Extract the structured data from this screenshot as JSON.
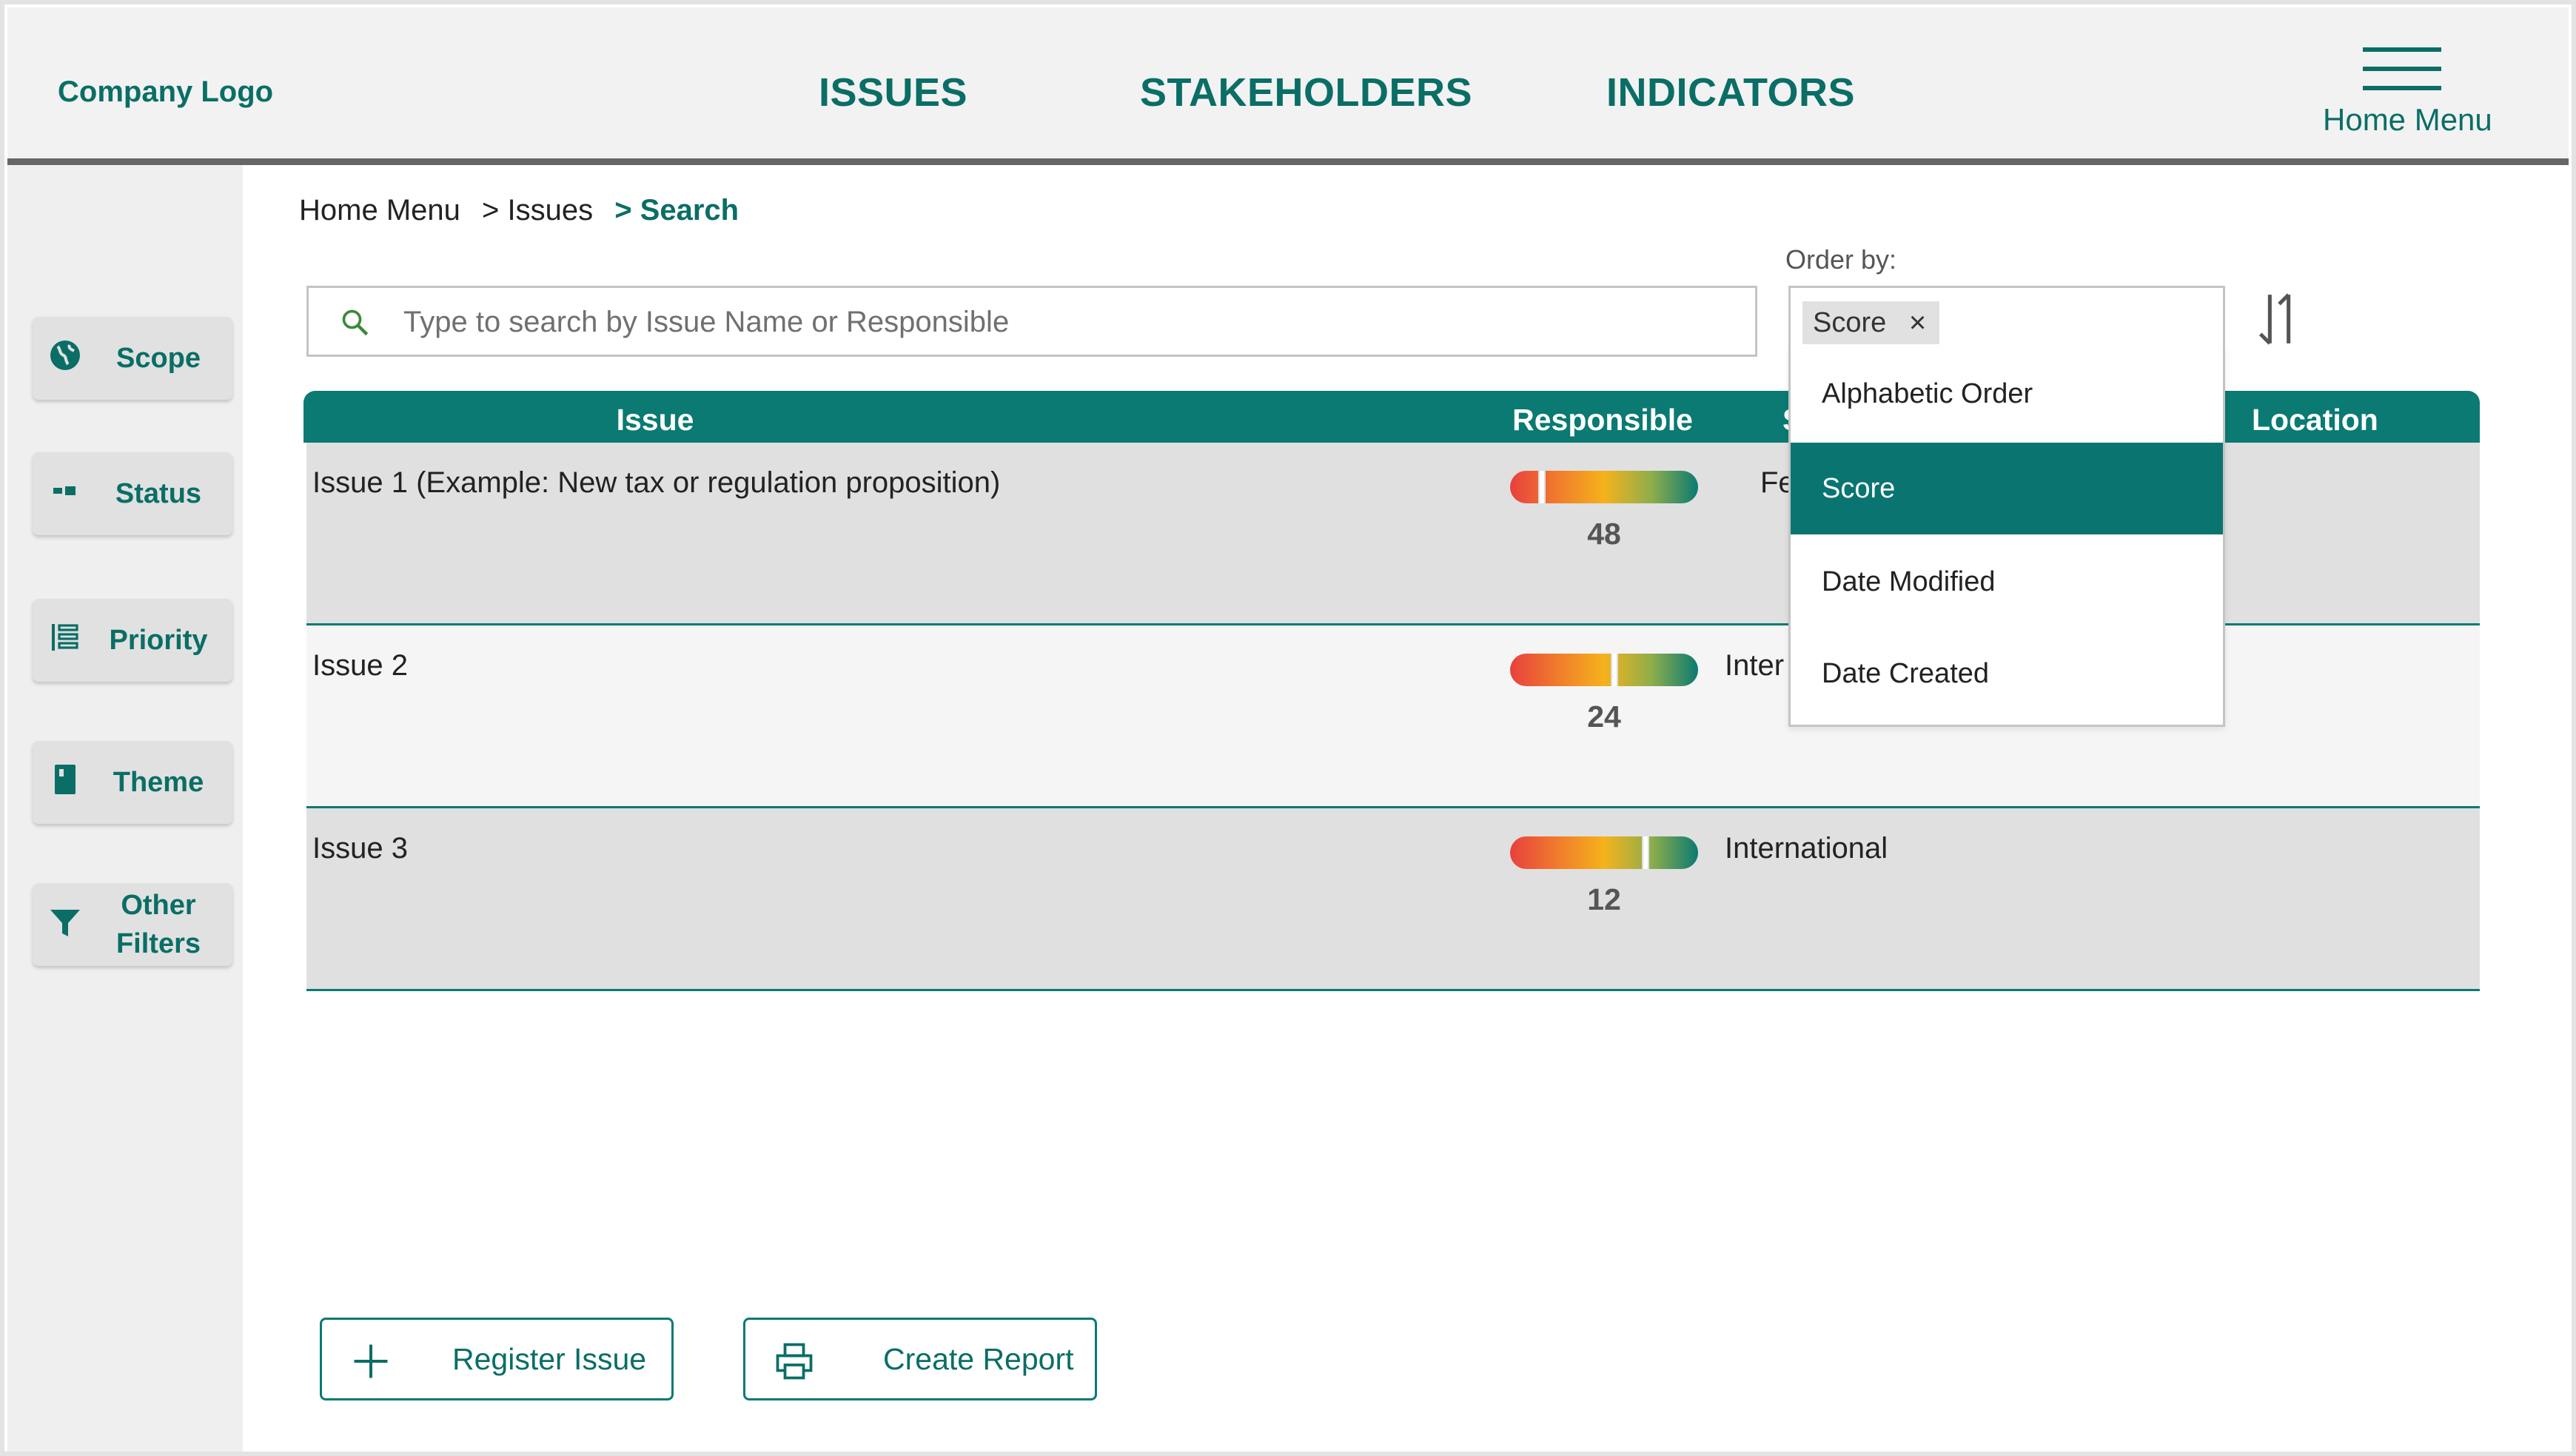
{
  "header": {
    "logo": "Company Logo",
    "nav": [
      "ISSUES",
      "STAKEHOLDERS",
      "INDICATORS"
    ],
    "home_menu": "Home Menu"
  },
  "sidebar": {
    "items": [
      {
        "label": "Scope",
        "icon": "globe-icon"
      },
      {
        "label": "Status",
        "icon": "status-icon"
      },
      {
        "label": "Priority",
        "icon": "priority-list-icon"
      },
      {
        "label": "Theme",
        "icon": "book-icon"
      },
      {
        "label": "Other Filters",
        "icon": "filter-icon"
      }
    ]
  },
  "breadcrumb": {
    "items": [
      "Home Menu",
      "> Issues",
      "> Search"
    ]
  },
  "search": {
    "placeholder": "Type to search by Issue Name or Responsible",
    "value": ""
  },
  "order_by": {
    "label": "Order by:",
    "selected": "Score",
    "options": [
      "Alphabetic Order",
      "Score",
      "Date Modified",
      "Date Created"
    ]
  },
  "table": {
    "columns": [
      "Issue",
      "Responsible",
      "Score",
      "Sc",
      "Location"
    ],
    "rows": [
      {
        "issue": "Issue 1 (Example: New tax or regulation proposition)",
        "responsible": "",
        "score": "48",
        "score_fraction": 0.18,
        "scope": "Fe",
        "location": ""
      },
      {
        "issue": "Issue 2",
        "responsible": "",
        "score": "24",
        "score_fraction": 0.55,
        "scope": "Inter",
        "location": ""
      },
      {
        "issue": "Issue 3",
        "responsible": "",
        "score": "12",
        "score_fraction": 0.72,
        "scope": "International",
        "location": ""
      }
    ]
  },
  "buttons": {
    "register": "Register Issue",
    "report": "Create Report"
  },
  "colors": {
    "primary": "#0a7a72",
    "text_accent": "#0a6e66",
    "row_grey": "#e0e0e0"
  }
}
